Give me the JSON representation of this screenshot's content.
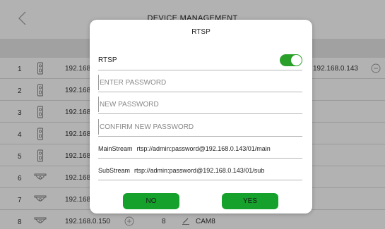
{
  "screen": {
    "title": "DEVICE MANAGEMENT"
  },
  "devices": [
    {
      "num": "1",
      "ip": "192.168.",
      "type": "doorbell"
    },
    {
      "num": "2",
      "ip": "192.168.",
      "type": "doorbell"
    },
    {
      "num": "3",
      "ip": "192.168.",
      "type": "doorbell"
    },
    {
      "num": "4",
      "ip": "192.168.",
      "type": "doorbell"
    },
    {
      "num": "5",
      "ip": "192.168.",
      "type": "doorbell"
    },
    {
      "num": "6",
      "ip": "192.168.",
      "type": "dome-camera"
    },
    {
      "num": "7",
      "ip": "192.168.",
      "type": "dome-camera"
    },
    {
      "num": "8",
      "ip": "192.168.0.150",
      "type": "dome-camera"
    }
  ],
  "right_panel": {
    "row1_ip": "192.168.0.143",
    "row8_channel": "8",
    "row8_name": "CAM8"
  },
  "modal": {
    "title": "RTSP",
    "rtsp_label": "RTSP",
    "rtsp_enabled": true,
    "enter_password_placeholder": "ENTER PASSWORD",
    "new_password_placeholder": "NEW PASSWORD",
    "confirm_password_placeholder": "CONFIRM NEW PASSWORD",
    "main_stream_label": "MainStream",
    "main_stream_url": "rtsp://admin:password@192.168.0.143/01/main",
    "sub_stream_label": "SubStream",
    "sub_stream_url": "rtsp://admin:password@192.168.0.143/01/sub",
    "no_label": "NO",
    "yes_label": "YES"
  },
  "colors": {
    "accent": "#16a12d",
    "toggle": "#2aa02a",
    "band": "#e7e7e7"
  },
  "icons": [
    "back-arrow-icon",
    "doorbell-icon",
    "dome-camera-icon",
    "minus-circle-icon",
    "plus-circle-icon",
    "pencil-icon"
  ]
}
